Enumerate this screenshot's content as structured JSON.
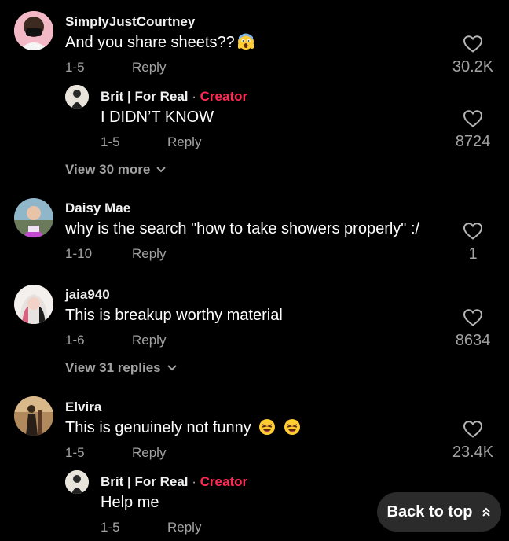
{
  "back_to_top_label": "Back to top",
  "comments": [
    {
      "username": "SimplyJustCourtney",
      "text": "And you share sheets??",
      "emoji": "shocked-face-emoji",
      "date": "1-5",
      "reply_label": "Reply",
      "likes": "30.2K",
      "replies": [
        {
          "username": "Brit | For Real",
          "separator": "·",
          "badge": "Creator",
          "text": "I DIDN’T KNOW",
          "date": "1-5",
          "reply_label": "Reply",
          "likes": "8724"
        }
      ],
      "view_more_label": "View 30 more"
    },
    {
      "username": "Daisy Mae",
      "text": "why is the search \"how to take showers properly\" :/",
      "date": "1-10",
      "reply_label": "Reply",
      "likes": "1"
    },
    {
      "username": "jaia940",
      "text": "This is breakup worthy material",
      "date": "1-6",
      "reply_label": "Reply",
      "likes": "8634",
      "view_more_label": "View 31 replies"
    },
    {
      "username": "Elvira",
      "text": "This is genuinely not funny",
      "emoji": "tired-face-emoji",
      "date": "1-5",
      "reply_label": "Reply",
      "likes": "23.4K",
      "replies": [
        {
          "username": "Brit | For Real",
          "separator": "·",
          "badge": "Creator",
          "text": "Help me",
          "date": "1-5",
          "reply_label": "Reply"
        }
      ]
    }
  ],
  "colors": {
    "background": "#000000",
    "creator_badge": "#fe2c55",
    "secondary_text": "#a2a2a2"
  }
}
